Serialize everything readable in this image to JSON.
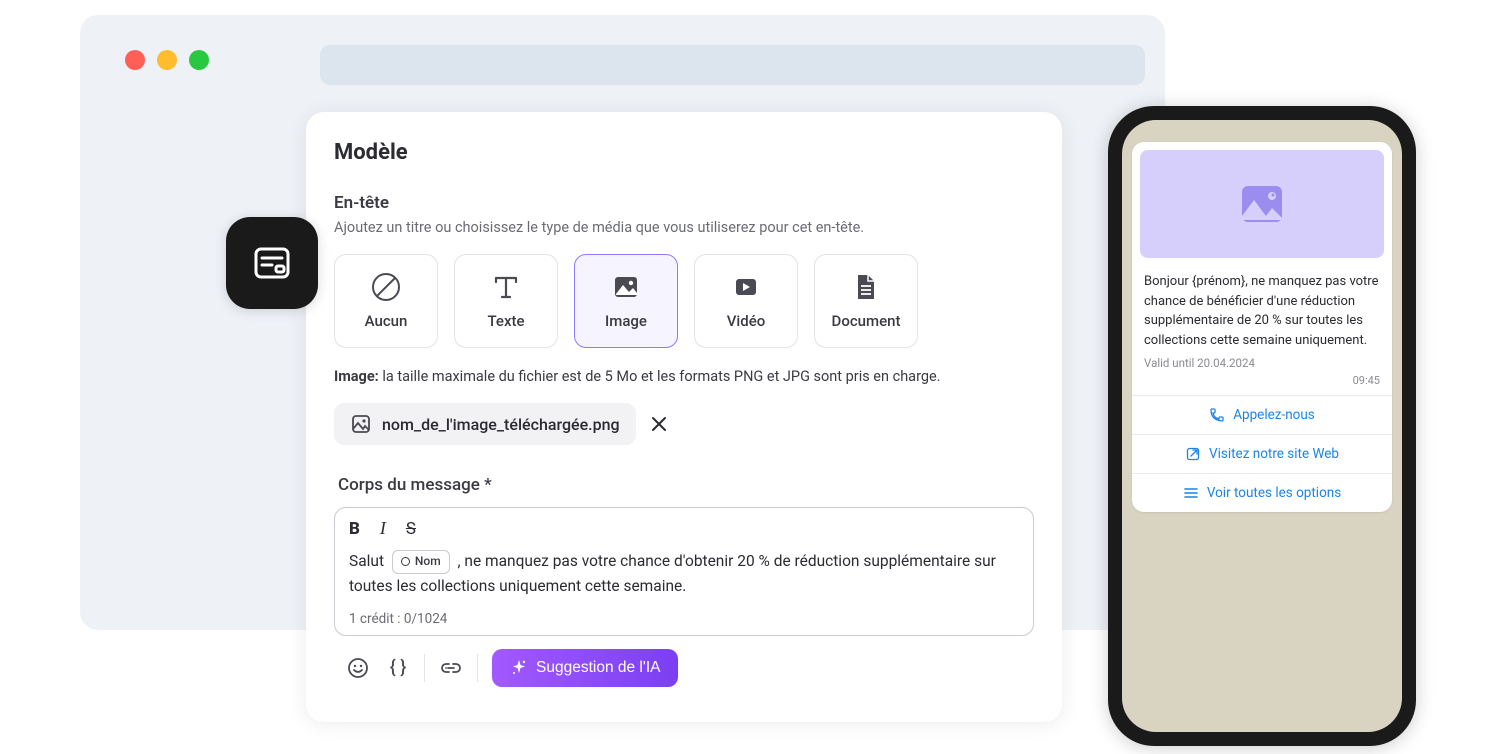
{
  "card": {
    "title": "Modèle",
    "header": {
      "label": "En-tête",
      "desc": "Ajoutez un titre ou choisissez le type de média que vous utiliserez pour cet en-tête."
    },
    "media_options": [
      {
        "key": "aucun",
        "label": "Aucun"
      },
      {
        "key": "texte",
        "label": "Texte"
      },
      {
        "key": "image",
        "label": "Image",
        "selected": true
      },
      {
        "key": "video",
        "label": "Vidéo"
      },
      {
        "key": "document",
        "label": "Document"
      }
    ],
    "image_hint": {
      "prefix": "Image:",
      "text": " la taille maximale du fichier est de 5 Mo et les formats PNG et JPG sont pris en charge."
    },
    "file_chip": "nom_de_l'image_téléchargée.png",
    "body_label": "Corps du message *",
    "body_variable": "Nom",
    "body_prefix": "Salut ",
    "body_suffix": " , ne manquez pas votre chance d'obtenir 20 % de réduction supplémentaire sur toutes les collections uniquement cette semaine.",
    "credits": "1 crédit : 0/1024",
    "ai_button": "Suggestion de l'IA"
  },
  "preview": {
    "body": "Bonjour {prénom}, ne manquez pas votre chance de bénéficier d'une réduction supplémentaire de 20 % sur toutes les collections cette semaine uniquement.",
    "valid": "Valid until 20.04.2024",
    "time": "09:45",
    "actions": [
      "Appelez-nous",
      "Visitez notre site Web",
      "Voir toutes les options"
    ]
  }
}
